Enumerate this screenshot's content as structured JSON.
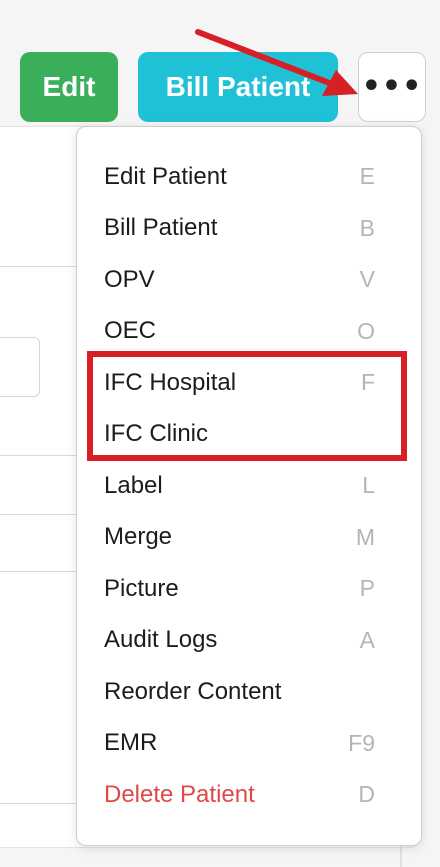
{
  "toolbar": {
    "edit_label": "Edit",
    "bill_label": "Bill Patient",
    "more_label": "•••",
    "edit_color": "#3aaf5a",
    "bill_color": "#1ec1d6"
  },
  "menu": {
    "items": [
      {
        "label": "Edit Patient",
        "shortcut": "E"
      },
      {
        "label": "Bill Patient",
        "shortcut": "B"
      },
      {
        "label": "OPV",
        "shortcut": "V"
      },
      {
        "label": "OEC",
        "shortcut": "O"
      },
      {
        "label": "IFC Hospital",
        "shortcut": "F"
      },
      {
        "label": "IFC Clinic",
        "shortcut": ""
      },
      {
        "label": "Label",
        "shortcut": "L"
      },
      {
        "label": "Merge",
        "shortcut": "M"
      },
      {
        "label": "Picture",
        "shortcut": "P"
      },
      {
        "label": "Audit Logs",
        "shortcut": "A"
      },
      {
        "label": "Reorder Content",
        "shortcut": ""
      },
      {
        "label": "EMR",
        "shortcut": "F9"
      },
      {
        "label": "Delete Patient",
        "shortcut": "D"
      }
    ],
    "danger_color": "#e04848"
  },
  "annotation": {
    "color": "#d71f26"
  }
}
